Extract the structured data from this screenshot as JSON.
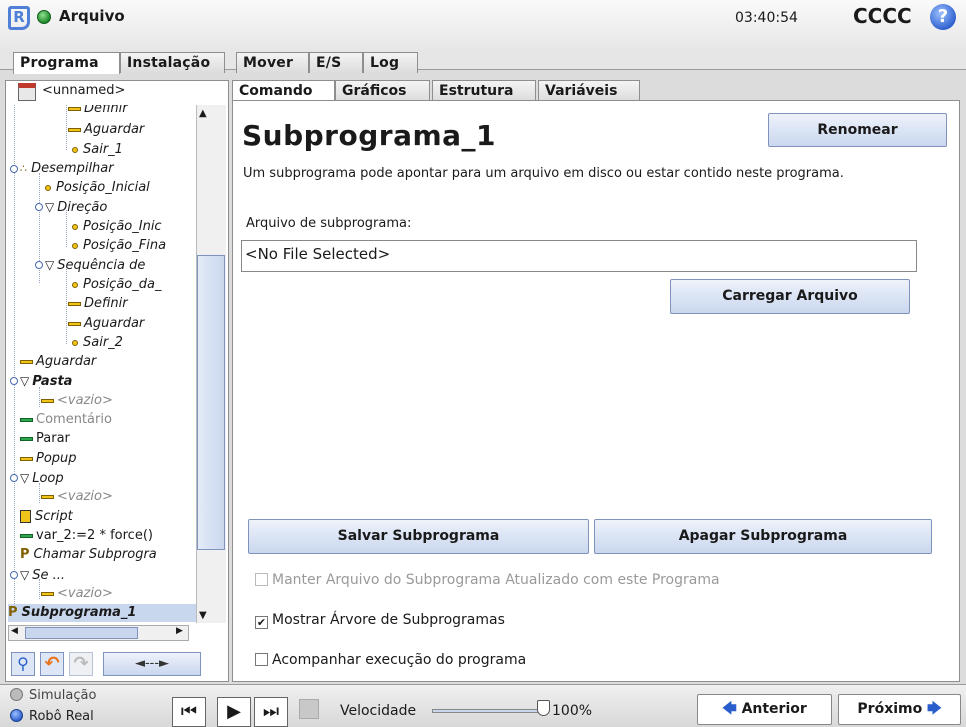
{
  "header": {
    "title": "Arquivo",
    "clock": "03:40:54",
    "robot_name": "CCCC",
    "help_glyph": "?"
  },
  "main_tabs": [
    {
      "label": "Programa"
    },
    {
      "label": "Instalação"
    },
    {
      "label": "Mover"
    },
    {
      "label": "E/S"
    },
    {
      "label": "Log"
    }
  ],
  "program": {
    "name": "<unnamed>"
  },
  "sub_tabs": [
    {
      "label": "Comando"
    },
    {
      "label": "Gráficos"
    },
    {
      "label": "Estrutura"
    },
    {
      "label": "Variáveis"
    }
  ],
  "tree": [
    {
      "label": "Definir",
      "icon": "bar"
    },
    {
      "label": "Aguardar",
      "icon": "bar-yellow"
    },
    {
      "label": "Sair_1",
      "icon": "waypoint"
    },
    {
      "label": "Desempilhar",
      "icon": "stack"
    },
    {
      "label": "Posição_Inicial",
      "icon": "waypoint"
    },
    {
      "label": "Direção",
      "icon": "triangle"
    },
    {
      "label": "Posição_Inic",
      "icon": "waypoint"
    },
    {
      "label": "Posição_Fina",
      "icon": "waypoint"
    },
    {
      "label": "Sequência de",
      "icon": "triangle"
    },
    {
      "label": "Posição_da_",
      "icon": "waypoint"
    },
    {
      "label": "Definir",
      "icon": "bar-yellow"
    },
    {
      "label": "Aguardar",
      "icon": "bar-yellow"
    },
    {
      "label": "Sair_2",
      "icon": "waypoint"
    },
    {
      "label": "Aguardar",
      "icon": "bar-yellow"
    },
    {
      "label": "Pasta",
      "icon": "triangle"
    },
    {
      "label": "<vazio>",
      "icon": "bar-yellow"
    },
    {
      "label": "Comentário",
      "icon": "bar-green"
    },
    {
      "label": "Parar",
      "icon": "bar-green"
    },
    {
      "label": "Popup",
      "icon": "bar-yellow"
    },
    {
      "label": "Loop",
      "icon": "triangle"
    },
    {
      "label": "<vazio>",
      "icon": "bar-yellow"
    },
    {
      "label": "Script",
      "icon": "script"
    },
    {
      "label": "var_2:=2 * force()",
      "icon": "bar-green"
    },
    {
      "label": "Chamar Subprogra",
      "icon": "p-icon"
    },
    {
      "label": "Se ...",
      "icon": "triangle"
    },
    {
      "label": "<vazio>",
      "icon": "bar-yellow"
    },
    {
      "label": "Subprograma_1",
      "icon": "p-icon"
    }
  ],
  "nav_arrow": "◄---►",
  "main": {
    "title": "Subprograma_1",
    "rename_label": "Renomear",
    "description": "Um subprograma pode apontar para um arquivo em disco ou estar contido neste programa.",
    "file_label": "Arquivo de subprograma:",
    "file_value": "<No File Selected>",
    "load_label": "Carregar Arquivo",
    "save_label": "Salvar Subprograma",
    "delete_label": "Apagar Subprograma",
    "keep_updated": {
      "label": "Manter Arquivo do Subprograma Atualizado com este Programa",
      "checked": false,
      "enabled": false
    },
    "show_tree": {
      "label": "Mostrar Árvore de Subprogramas",
      "checked": true
    },
    "follow_exec": {
      "label": "Acompanhar execução do programa",
      "checked": false
    }
  },
  "footer": {
    "simulation_label": "Simulação",
    "real_label": "Robô Real",
    "speed_label": "Velocidade",
    "speed_value": "100%",
    "speed_fraction": 1.0,
    "prev_label": "Anterior",
    "next_label": "Próximo"
  },
  "colors": {
    "accent": "#c9d7ee",
    "accent_border": "#7f93bc",
    "logo": "#4f7fd6",
    "status_green": "#2ea84a"
  }
}
